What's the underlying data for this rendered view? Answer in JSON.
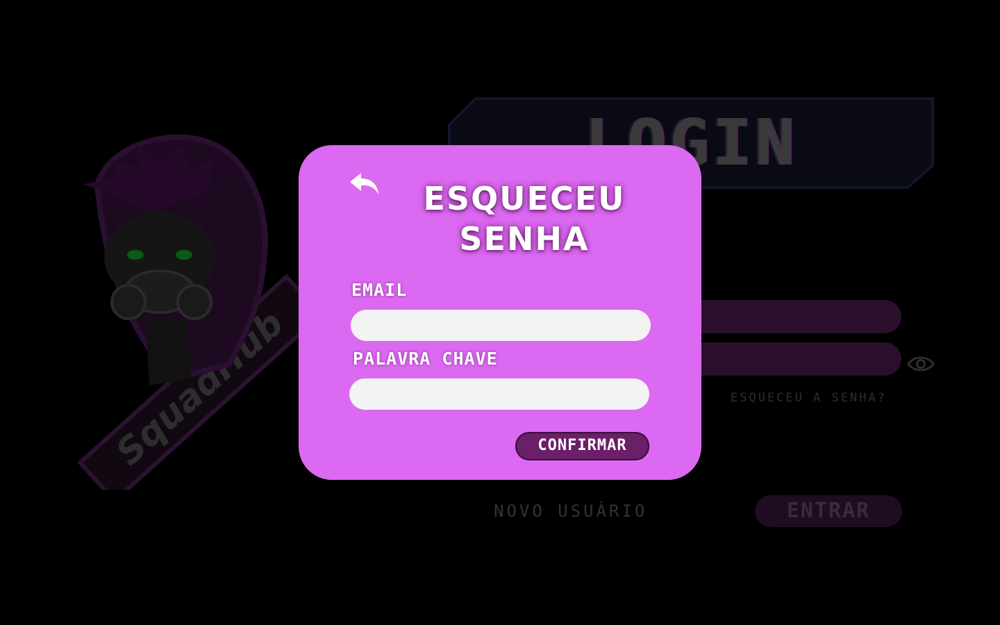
{
  "background": {
    "logo_text": "SquadHub",
    "banner_title": "LOGIN",
    "forgot_link": "ESQUECEU A SENHA?",
    "new_user_link": "NOVO USUÁRIO",
    "enter_button": "ENTRAR"
  },
  "modal": {
    "title_line1": "ESQUECEU",
    "title_line2": "SENHA",
    "email_label": "EMAIL",
    "email_value": "",
    "password_label": "PALAVRA CHAVE",
    "password_value": "",
    "confirm_button": "CONFIRMAR"
  },
  "colors": {
    "page_bg": "#000000",
    "modal_bg": "#dc69f2",
    "confirm_bg": "#6a1f68",
    "input_bg": "#f3f3f3"
  },
  "icons": {
    "back": "back-arrow-icon",
    "eye": "eye-icon"
  }
}
